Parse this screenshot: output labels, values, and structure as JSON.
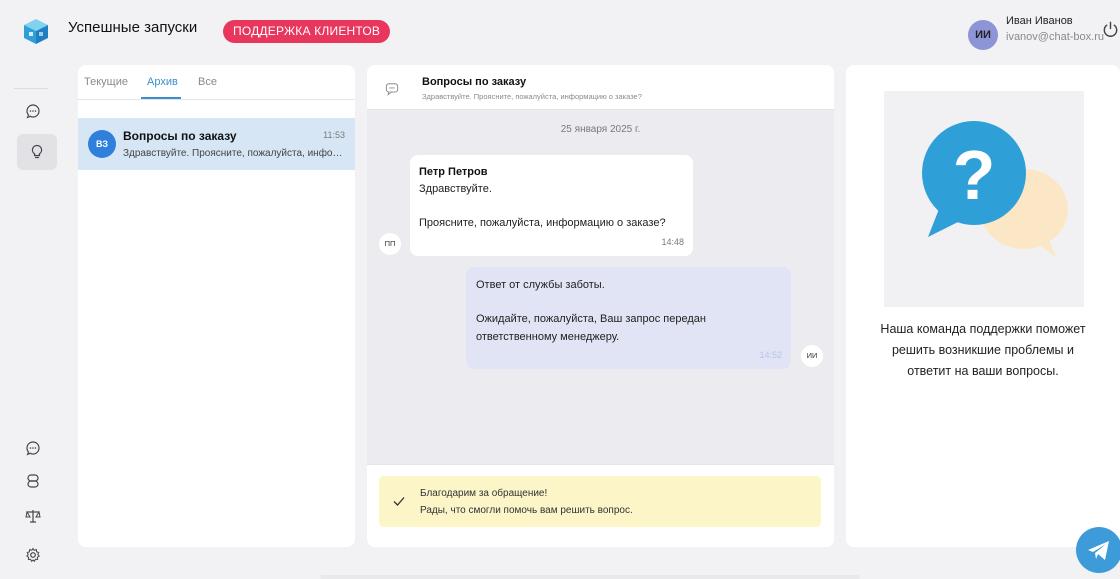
{
  "header": {
    "logo_icon": "cube-logo-icon",
    "title": "Успешные запуски",
    "badge": "ПОДДЕРЖКА КЛИЕНТОВ",
    "user": {
      "initials": "ИИ",
      "name": "Иван Иванов",
      "email": "ivanov@chat-box.ru"
    },
    "logout_icon": "power-icon"
  },
  "sidebar": {
    "top_items": [
      {
        "icon": "chat-bubble-icon",
        "active": false
      },
      {
        "icon": "lightbulb-icon",
        "active": true
      }
    ],
    "bottom_items": [
      {
        "icon": "chat-bubble-icon"
      },
      {
        "icon": "database-icon"
      },
      {
        "icon": "scales-icon"
      },
      {
        "icon": "gear-icon"
      }
    ]
  },
  "conversation_list": {
    "tabs": [
      "Текущие",
      "Архив",
      "Все"
    ],
    "active_tab": "Архив",
    "items": [
      {
        "initials": "ВЗ",
        "title": "Вопросы по заказу",
        "time": "11:53",
        "preview": "Здравствуйте. Проясните, пожалуйста, информацию о заказе?"
      }
    ]
  },
  "chat": {
    "title": "Вопросы по заказу",
    "subtitle": "Здравствуйте. Проясните, пожалуйста, информацию о заказе?",
    "date": "25 января 2025 г.",
    "messages": [
      {
        "direction": "in",
        "sender": "Петр Петров",
        "avatar": "ПП",
        "lines": [
          "Здравствуйте.",
          "",
          "Проясните, пожалуйста, информацию о заказе?"
        ],
        "time": "14:48"
      },
      {
        "direction": "out",
        "avatar": "ИИ",
        "lines": [
          "Ответ от службы заботы.",
          "",
          "Ожидайте, пожалуйста, Ваш запрос передан",
          "ответственному менеджеру."
        ],
        "time": "14:52"
      }
    ],
    "notice": {
      "line1": "Благодарим за обращение!",
      "line2": "Рады, что смогли помочь вам решить вопрос."
    }
  },
  "info_panel": {
    "illustration_icon": "question-bubble-icon",
    "lines": [
      "Наша команда поддержки поможет",
      "решить возникшие проблемы и",
      "ответит на ваши вопросы."
    ]
  },
  "floating": {
    "icon": "telegram-icon"
  },
  "colors": {
    "accent": "#3a8ecf",
    "badge": "#e8365d",
    "selected_row": "#d6e6f5",
    "notice_bg": "#fbf5c8",
    "outgoing_bubble": "#e1e4f4"
  }
}
